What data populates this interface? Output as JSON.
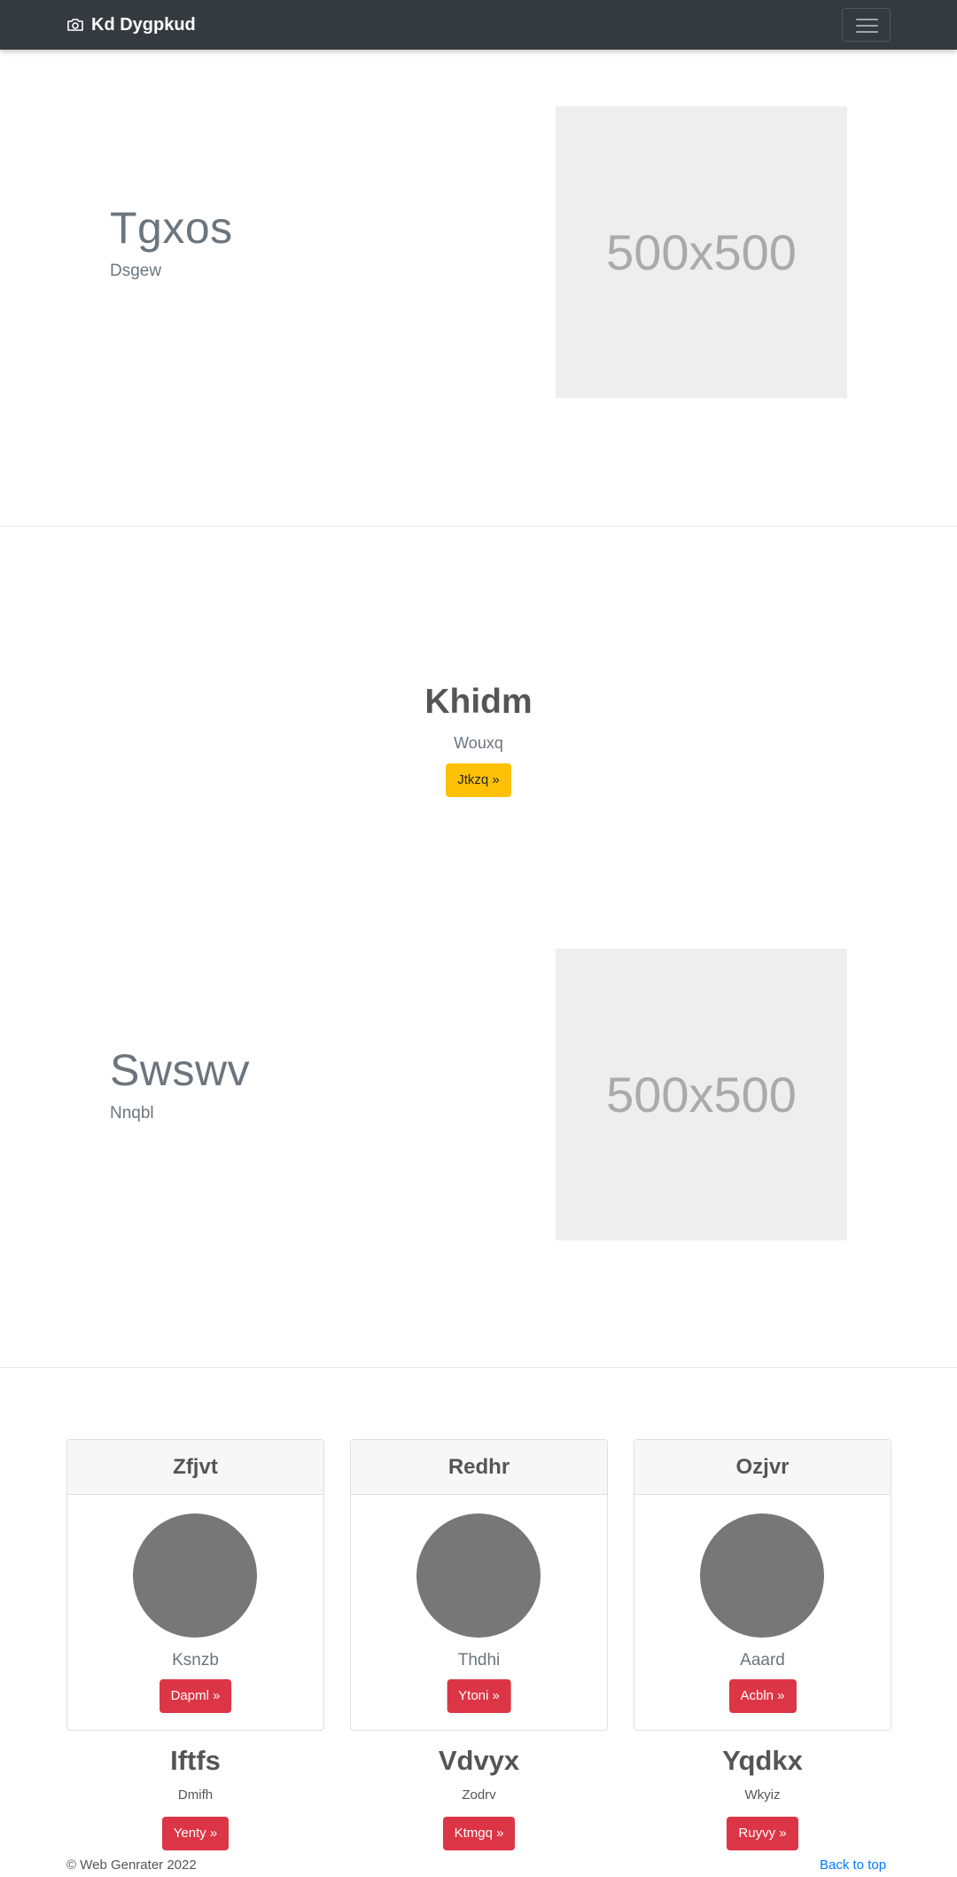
{
  "navbar": {
    "brand": "Kd Dygpkud",
    "brand_icon": "camera-icon",
    "toggler_icon": "hamburger-icon"
  },
  "feature1": {
    "title": "Tgxos",
    "subtitle": "Dsgew",
    "image_label": "500x500"
  },
  "hero": {
    "title": "Khidm",
    "subtitle": "Wouxq",
    "button": "Jtkzq »"
  },
  "feature2": {
    "title": "Swswv",
    "subtitle": "Nnqbl",
    "image_label": "500x500"
  },
  "cards": [
    {
      "header": "Zfjvt",
      "text": "Ksnzb",
      "button": "Dapml »"
    },
    {
      "header": "Redhr",
      "text": "Thdhi",
      "button": "Ytoni »"
    },
    {
      "header": "Ozjvr",
      "text": "Aaard",
      "button": "Acbln »"
    }
  ],
  "columns": [
    {
      "title": "Iftfs",
      "text": "Dmifh",
      "button": "Yenty »"
    },
    {
      "title": "Vdvyx",
      "text": "Zodrv",
      "button": "Ktmgq »"
    },
    {
      "title": "Yqdkx",
      "text": "Wkyiz",
      "button": "Ruyvy »"
    }
  ],
  "footer": {
    "copyright": "© Web Genrater 2022",
    "back_to_top": "Back to top"
  },
  "colors": {
    "navbar": "#343a40",
    "warning": "#ffc107",
    "danger": "#dc3545",
    "link": "#007bff"
  }
}
